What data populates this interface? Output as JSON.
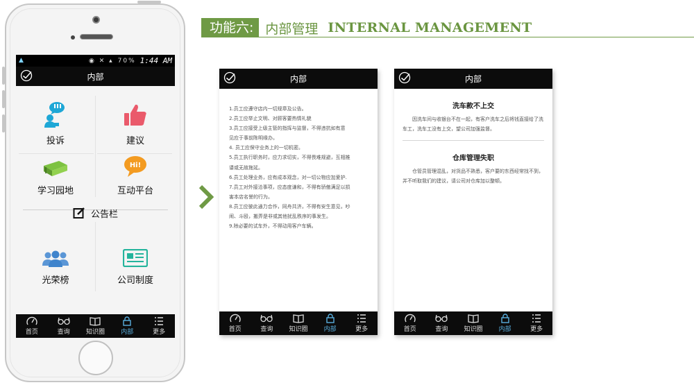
{
  "header": {
    "tag": "功能六:",
    "subtitle": "内部管理",
    "english": "INTERNAL MANAGEMENT"
  },
  "statusbar": {
    "time": "1:44 AM",
    "battery": "70%"
  },
  "screen_title": "内部",
  "menu": {
    "complaint": "投诉",
    "suggestion": "建议",
    "learning": "学习园地",
    "interaction": "互动平台",
    "notice_board": "公告栏",
    "honor_roll": "光荣榜",
    "company_rules": "公司制度"
  },
  "tabs": [
    "首页",
    "查询",
    "知识圈",
    "内部",
    "更多"
  ],
  "rules_screen": {
    "title": "内部",
    "lines": [
      "1.员工应遵守店内一切规章及公告。",
      "2.员工应举止文明、对顾客要热情礼貌",
      "3.员工应接受上级主管的指挥与监督，不得违抗如有意",
      "见应于事前陈明缘办。",
      "4. 员工应保守业务上的一切机密。",
      "5.员工执行职务时，应力求切实，不得畏难规避，互相推",
      "诿或无故拖延。",
      "6.员工处理业务，应有成本观念，对一切公物应加爱护.",
      "7.员工对外接洽事项，应态度谦和，不得有骄傲满足以损",
      "害本店名誉的行为。",
      "8.员工应彼此通力合作，同舟共济，不得有安生意见，吵",
      "闹、斗殴，搬弄是非或其他扰乱秩序的事发生。",
      "9.除必要的试车外，不得动用客户车辆。"
    ]
  },
  "notice_screen": {
    "title": "内部",
    "items": [
      {
        "title": "洗车款不上交",
        "body": "因洗车间与收银台不在一起，有客户洗车之后将钱直接给了洗车工，洗车工没有上交，望公司加强监督。"
      },
      {
        "title": "仓库管理失职",
        "body": "仓管员管理混乱，对货品不熟悉，客户要的东西经常找不到，并不听取我们的建议，请公司对仓库加以整顿。"
      }
    ]
  },
  "colors": {
    "brand_green": "#6f9a45",
    "active_tab": "#5ab0e0",
    "complaint_icon": "#1ea7d6",
    "suggestion_icon": "#ea5a6b",
    "learning_icon": "#7dc241",
    "interaction_icon": "#f39b21"
  }
}
